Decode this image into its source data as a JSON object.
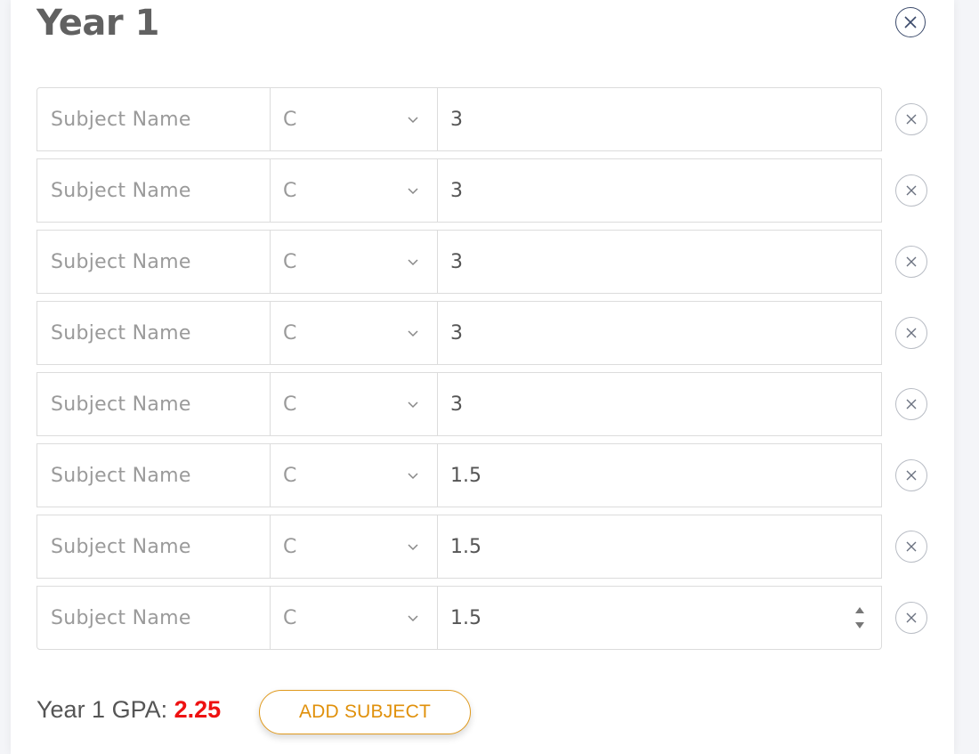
{
  "year": {
    "title": "Year 1",
    "close_icon": "close-circle-icon"
  },
  "subjects": [
    {
      "name_placeholder": "Subject  Name",
      "grade": "C",
      "credits": "3"
    },
    {
      "name_placeholder": "Subject  Name",
      "grade": "C",
      "credits": "3"
    },
    {
      "name_placeholder": "Subject  Name",
      "grade": "C",
      "credits": "3"
    },
    {
      "name_placeholder": "Subject  Name",
      "grade": "C",
      "credits": "3"
    },
    {
      "name_placeholder": "Subject  Name",
      "grade": "C",
      "credits": "3"
    },
    {
      "name_placeholder": "Subject  Name",
      "grade": "C",
      "credits": "1.5"
    },
    {
      "name_placeholder": "Subject  Name",
      "grade": "C",
      "credits": "1.5"
    },
    {
      "name_placeholder": "Subject  Name",
      "grade": "C",
      "credits": "1.5"
    }
  ],
  "footer": {
    "gpa_label": "Year 1 GPA:",
    "gpa_value": "2.25",
    "add_subject_label": "ADD SUBJECT"
  },
  "colors": {
    "gpa_value": "#ee1111",
    "accent": "#e09a1e",
    "close_border": "#3b4a6b"
  }
}
